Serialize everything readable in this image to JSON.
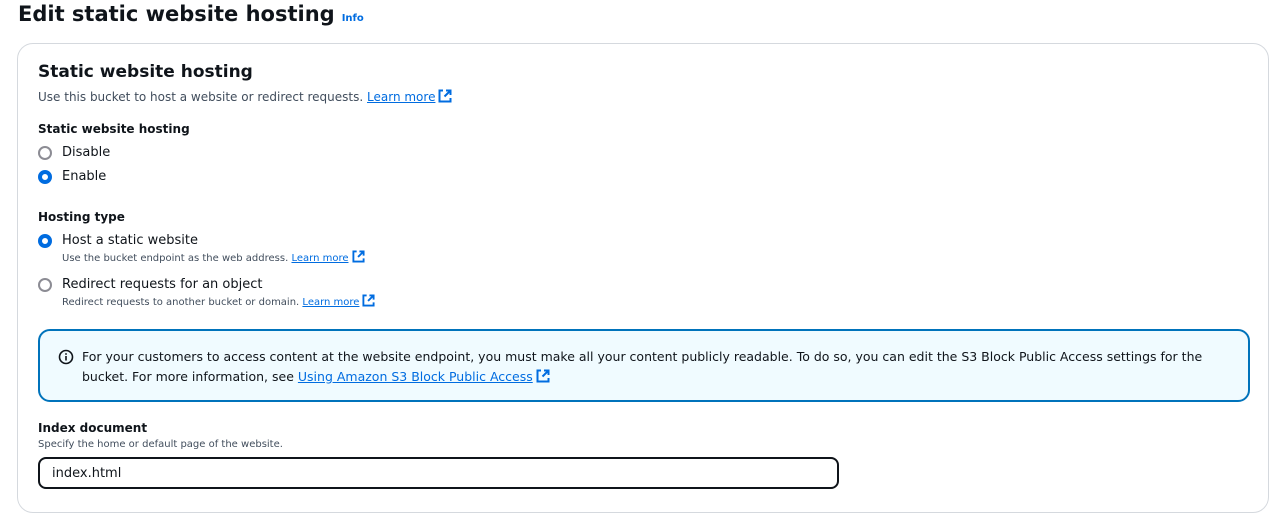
{
  "page": {
    "title": "Edit static website hosting",
    "info_label": "Info"
  },
  "panel": {
    "title": "Static website hosting",
    "description": "Use this bucket to host a website or redirect requests.",
    "learn_more": "Learn more"
  },
  "hosting_toggle": {
    "label": "Static website hosting",
    "options": [
      {
        "label": "Disable",
        "checked": false
      },
      {
        "label": "Enable",
        "checked": true
      }
    ]
  },
  "hosting_type": {
    "label": "Hosting type",
    "options": [
      {
        "label": "Host a static website",
        "description": "Use the bucket endpoint as the web address.",
        "link": "Learn more",
        "checked": true
      },
      {
        "label": "Redirect requests for an object",
        "description": "Redirect requests to another bucket or domain.",
        "link": "Learn more",
        "checked": false
      }
    ]
  },
  "alert": {
    "text": "For your customers to access content at the website endpoint, you must make all your content publicly readable. To do so, you can edit the S3 Block Public Access settings for the bucket. For more information, see",
    "link": "Using Amazon S3 Block Public Access"
  },
  "index_document": {
    "label": "Index document",
    "description": "Specify the home or default page of the website.",
    "value": "index.html"
  },
  "colors": {
    "accent": "#006ce0",
    "alert_border": "#0073bb",
    "alert_bg": "#f0fbff"
  },
  "icons": {
    "external_link": "external-link-icon",
    "info": "info-circle-icon"
  }
}
